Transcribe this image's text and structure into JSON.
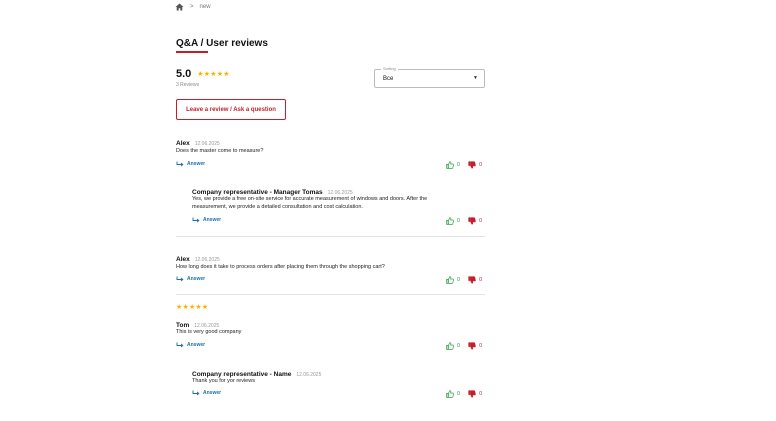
{
  "breadcrumb": {
    "home_icon": "home-icon",
    "separator": ">",
    "current": "new"
  },
  "title": "Q&A / User reviews",
  "rating": {
    "value": "5.0",
    "stars": "★★★★★",
    "count_text": "3 Reviews"
  },
  "sorting": {
    "label": "Sorting",
    "value": "Все"
  },
  "leave_review_button": "Leave a review / Ask a question",
  "answer_label": "Answer",
  "colors": {
    "accent": "#c51f2c",
    "link": "#1a6fb5",
    "like": "#2ea043",
    "star": "#f5b301"
  },
  "items": [
    {
      "author": "Alex",
      "date": "12.06.2025",
      "text": "Does the master come to measure?",
      "likes": "0",
      "dislikes": "0",
      "reply": {
        "author": "Company representative - Manager Tomas",
        "date": "12.06.2025",
        "text_line1": "Yes, we provide a free on-site service for accurate measurement of windows and doors. After the",
        "text_line2": "measurement, we provide a detailed consultation and cost calculation.",
        "likes": "0",
        "dislikes": "0"
      }
    },
    {
      "author": "Alex",
      "date": "12.06.2025",
      "text": "How long does it take to process orders after placing them through the shopping cart?",
      "likes": "0",
      "dislikes": "0"
    },
    {
      "stars": "★★★★★",
      "author": "Tom",
      "date": "12.06.2025",
      "text": "This is very good company",
      "likes": "0",
      "dislikes": "0",
      "reply": {
        "author": "Company representative - Name",
        "date": "12.06.2025",
        "text": "Thank you for yor reviews",
        "likes": "0",
        "dislikes": "0"
      }
    }
  ]
}
